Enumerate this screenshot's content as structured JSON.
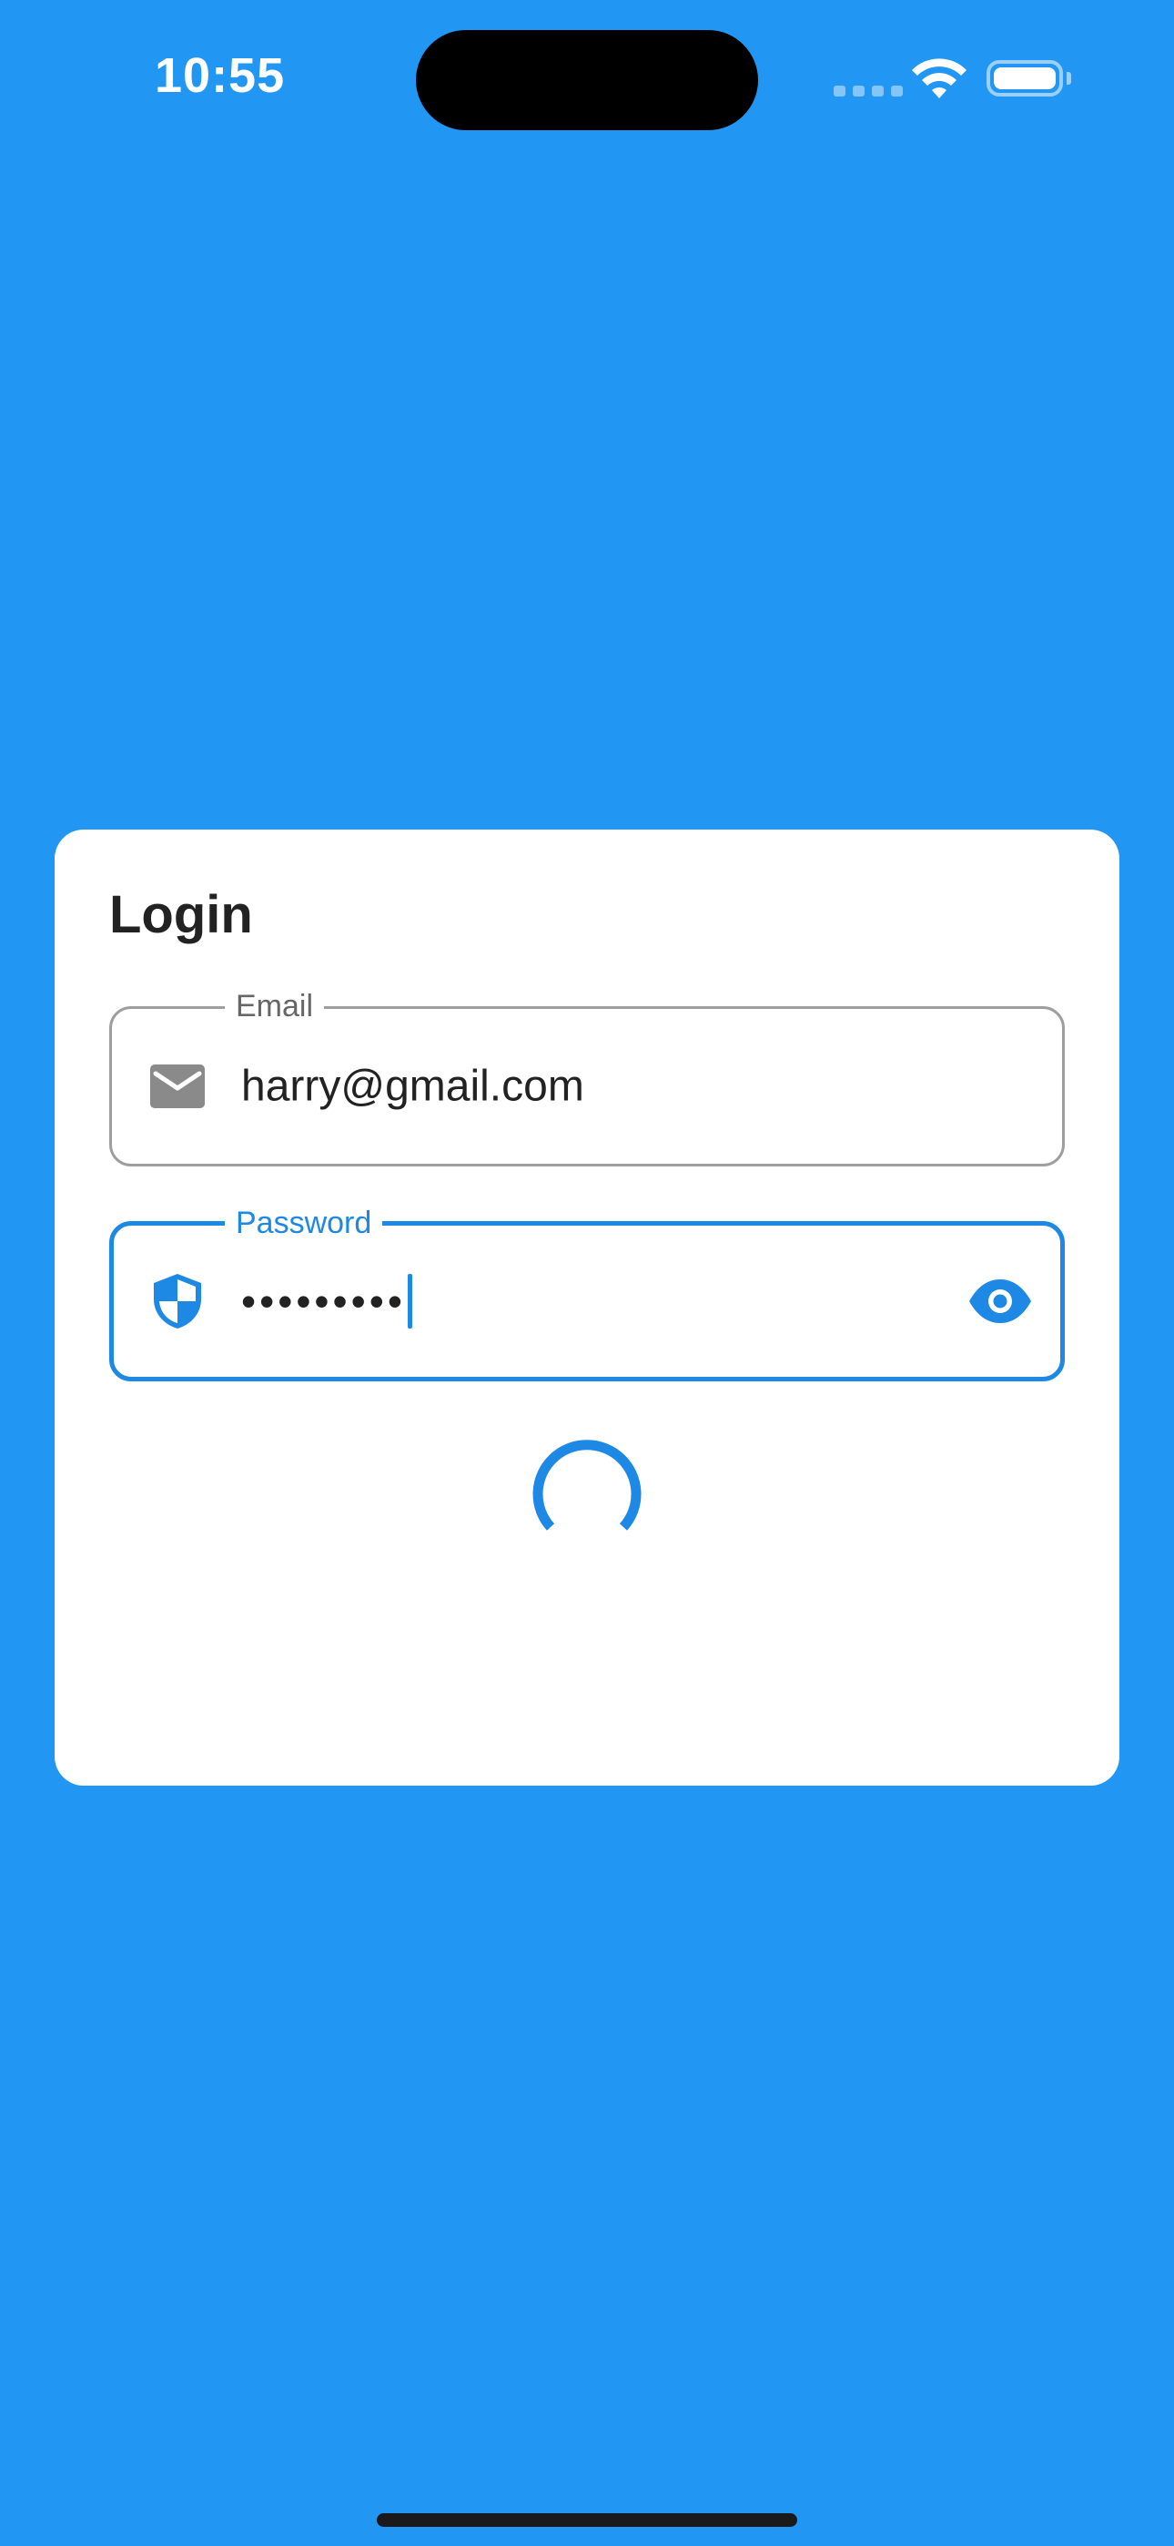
{
  "status_bar": {
    "time": "10:55"
  },
  "login_card": {
    "title": "Login",
    "email_field": {
      "label": "Email",
      "value": "harry@gmail.com",
      "icon": "mail-icon"
    },
    "password_field": {
      "label": "Password",
      "masked_value": "•••••••••",
      "icon": "shield-icon",
      "toggle_icon": "eye-icon",
      "focused": true
    },
    "loading": true
  },
  "colors": {
    "background": "#2196F3",
    "accent": "#1E88E5",
    "card": "#FFFFFF",
    "text": "#222222",
    "outline_inactive": "#9E9E9E"
  }
}
